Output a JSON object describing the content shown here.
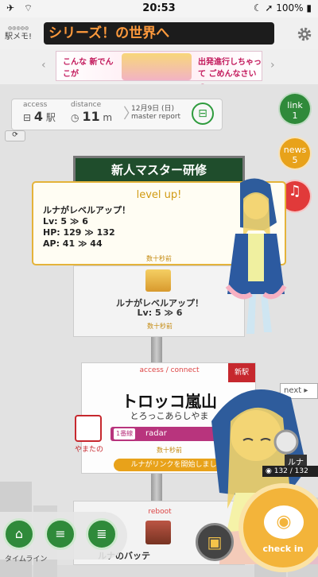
{
  "status": {
    "left": "✈ ⌔",
    "time": "20:53",
    "right": "☾ ➚ 100% ▮"
  },
  "header": {
    "app_name_top": "◎◎◎◎◎",
    "app_name": "駅メモ!",
    "ticker": "シリーズ！の世界へ"
  },
  "ad": {
    "text_left": "こんな 新でんこが",
    "text_right": "出発進行しちゃって ごめんなさいっ……",
    "prev": "‹",
    "next": "›"
  },
  "info": {
    "access_label": "access",
    "access_value": "4",
    "access_unit": "駅",
    "distance_label": "distance",
    "distance_value": "11",
    "distance_unit": "m",
    "date": "12月9日 (日)",
    "report": "master report",
    "train_icon": "train-icon"
  },
  "side": {
    "link_label": "link",
    "link_count": "1",
    "news_label": "news",
    "news_count": "5",
    "bell_icon": "bell-icon"
  },
  "sign": {
    "text": "新人マスター研修"
  },
  "levelup": {
    "title": "level up!",
    "line1": "ルナがレベルアップ！",
    "line2": "Lv: 5 ≫ 6",
    "line3": "HP: 129 ≫ 132",
    "line4": "AP: 41 ≫ 44",
    "time": "数十秒前"
  },
  "card2": {
    "line1": "ルナがレベルアップ！",
    "line2": "Lv: 5 ≫ 6",
    "time": "数十秒前"
  },
  "station": {
    "header": "access / connect",
    "new_badge": "新駅",
    "name": "トロッコ嵐山",
    "kana": "とろっこあらしやま",
    "radar_tag": "1番線",
    "radar_label": "radar",
    "time": "数十秒前",
    "link_text": "ルナがリンクを開始しました"
  },
  "yamatano": {
    "name": "やまたの"
  },
  "next": {
    "label": "next ▸"
  },
  "reboot": {
    "header": "reboot",
    "text": "ルナのバッテ"
  },
  "luna": {
    "name": "ルナ",
    "hp": "◉ 132 / 132"
  },
  "nav": {
    "home": "⌂",
    "list1": "≡",
    "list2": "≣",
    "timeline_label": "タイムライン"
  },
  "bag": {
    "icon": "▣"
  },
  "checkin": {
    "icon": "◉",
    "label": "check in"
  },
  "colors": {
    "accent_green": "#2f8a3a",
    "gold": "#e4b33a",
    "check_in": "#f3b43a",
    "link_red": "#e13a3a",
    "news_orange": "#e8a21a"
  }
}
